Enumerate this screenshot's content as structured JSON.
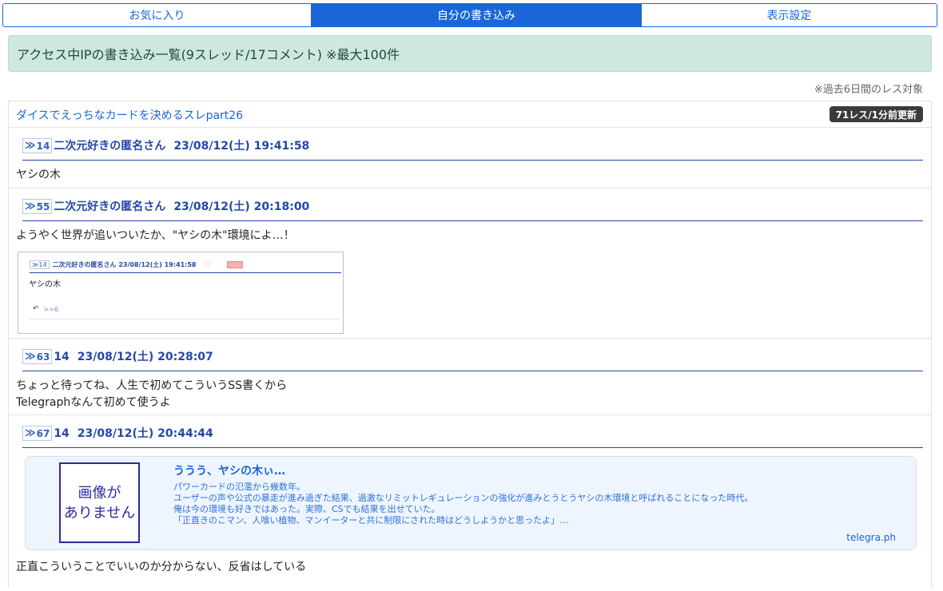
{
  "tabs": [
    {
      "label": "お気に入り"
    },
    {
      "label": "自分の書き込み"
    },
    {
      "label": "表示設定"
    }
  ],
  "banner": {
    "text": "アクセス中IPの書き込み一覧(9スレッド/17コメント) ※最大100件"
  },
  "note": {
    "text": "※過去6日間のレス対象"
  },
  "thread": {
    "title": "ダイスでえっちなカードを決めるスレpart26",
    "badge": "71レス/1分前更新"
  },
  "posts": [
    {
      "num": "14",
      "name": "二次元好きの匿名さん",
      "date": "23/08/12(土) 19:41:58",
      "body": [
        "ヤシの木"
      ]
    },
    {
      "num": "55",
      "name": "二次元好きの匿名さん",
      "date": "23/08/12(土) 20:18:00",
      "body": [
        "ようやく世界が追いついたか、\"ヤシの木\"環境によ…！"
      ],
      "screenshot": {
        "num": "14",
        "header": "二次元好きの匿名さん  23/08/12(土) 19:41:58",
        "body": "ヤシの木",
        "reply": ">>6"
      }
    },
    {
      "num": "63",
      "name": "14",
      "date": "23/08/12(土) 20:28:07",
      "body": [
        "ちょっと待ってね、人生で初めてこういうSS書くから",
        "Telegraphなんて初めて使うよ"
      ]
    },
    {
      "num": "67",
      "name": "14",
      "date": "23/08/12(土) 20:44:44",
      "card": {
        "noimg_line1": "画像が",
        "noimg_line2": "ありません",
        "title": "ううう、ヤシの木ぃ…",
        "desc": [
          "パワーカードの氾濫から幾数年。",
          "ユーザーの声や公式の暴走が進み過ぎた結果、過激なリミットレギュレーションの強化が進みとうとうヤシの木環境と呼ばれることになった時代。",
          "俺は今の環境も好きではあった。実際、CSでも結果を出せていた。",
          "「正直きのこマン、人喰い植物、マンイーターと共に制限にされた時はどうしようかと思ったよ」…"
        ],
        "domain": "telegra.ph"
      },
      "body": [
        "正直こういうことでいいのか分からない、反省はしている"
      ]
    }
  ],
  "colors": {
    "accent": "#1a66d6",
    "banner_bg": "#cfe8de",
    "post_head": "#2448a6",
    "badge_bg": "#3b3b3b"
  }
}
